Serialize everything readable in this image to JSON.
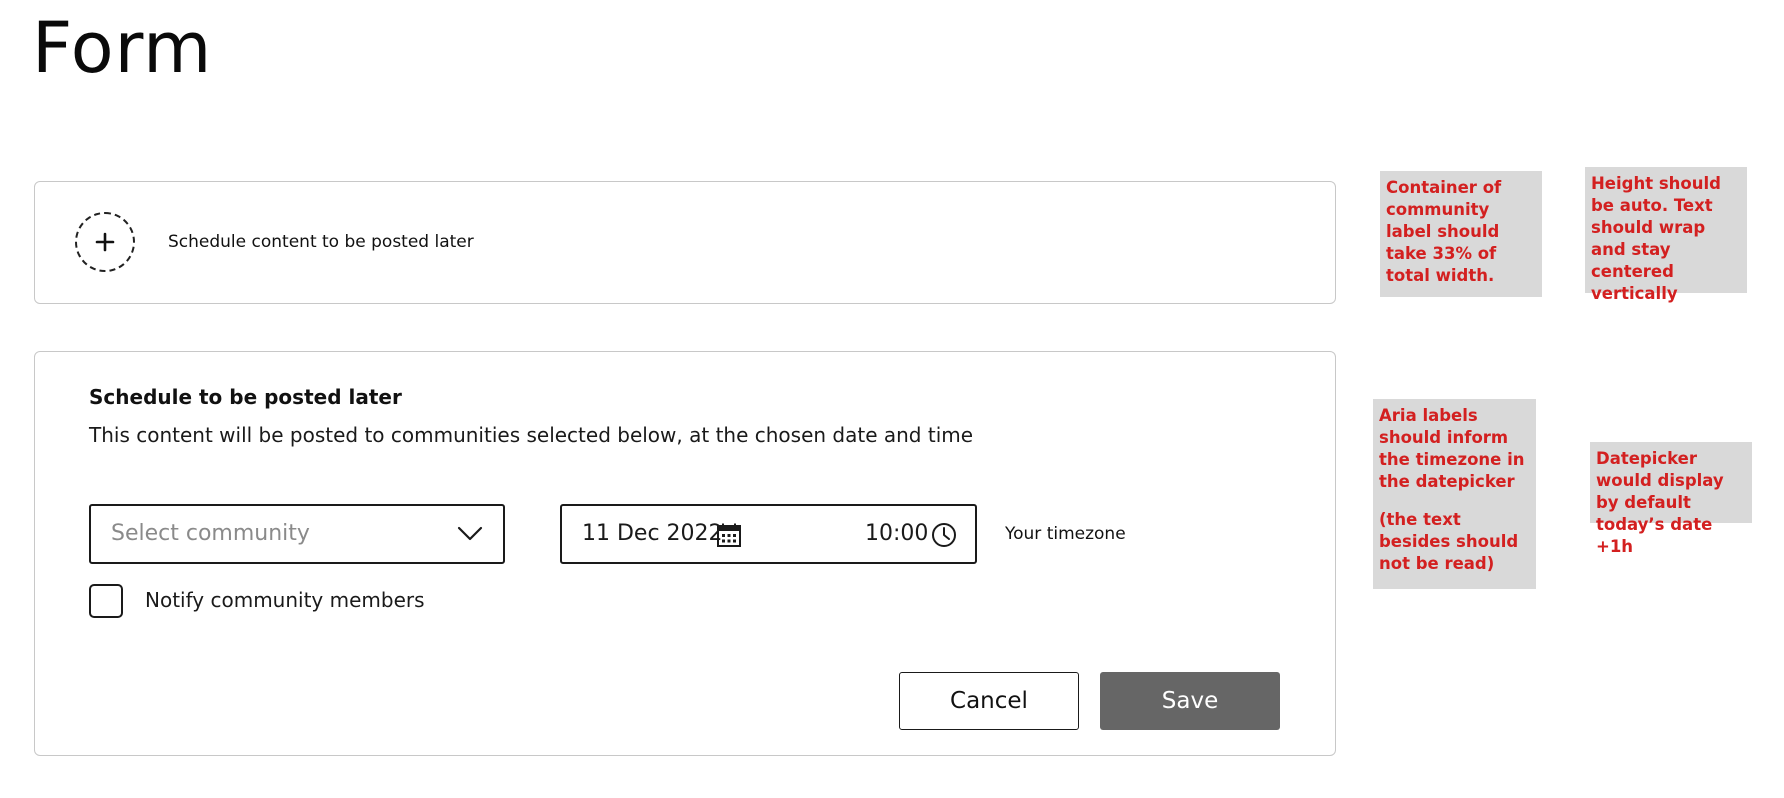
{
  "page": {
    "title": "Form"
  },
  "collapsed_card": {
    "icon": "plus-icon",
    "label": "Schedule content to be posted later"
  },
  "expanded_card": {
    "title": "Schedule to be posted later",
    "description": "This content will be posted to communities selected below, at the chosen date and time",
    "community_select": {
      "placeholder": "Select community",
      "icon": "chevron-down-icon"
    },
    "datetime": {
      "date": "11 Dec 2022",
      "date_icon": "calendar-icon",
      "time": "10:00",
      "time_icon": "clock-icon"
    },
    "timezone_label": "Your timezone",
    "notify": {
      "label": "Notify community members",
      "checked": false
    },
    "buttons": {
      "cancel": "Cancel",
      "save": "Save"
    }
  },
  "annotations": [
    {
      "paragraphs": [
        "Container of community label should take 33% of total width."
      ]
    },
    {
      "paragraphs": [
        "Height should be auto. Text should wrap and stay centered vertically"
      ]
    },
    {
      "paragraphs": [
        "Aria labels should inform the timezone in the datepicker",
        "(the text besides should not be read)"
      ]
    },
    {
      "paragraphs": [
        "Datepicker would display by default today’s date +1h"
      ]
    }
  ],
  "colors": {
    "annotation_text": "#d32020",
    "annotation_bg": "#d9d9d9",
    "save_button_bg": "#666666",
    "card_border": "#c8c8c8"
  }
}
